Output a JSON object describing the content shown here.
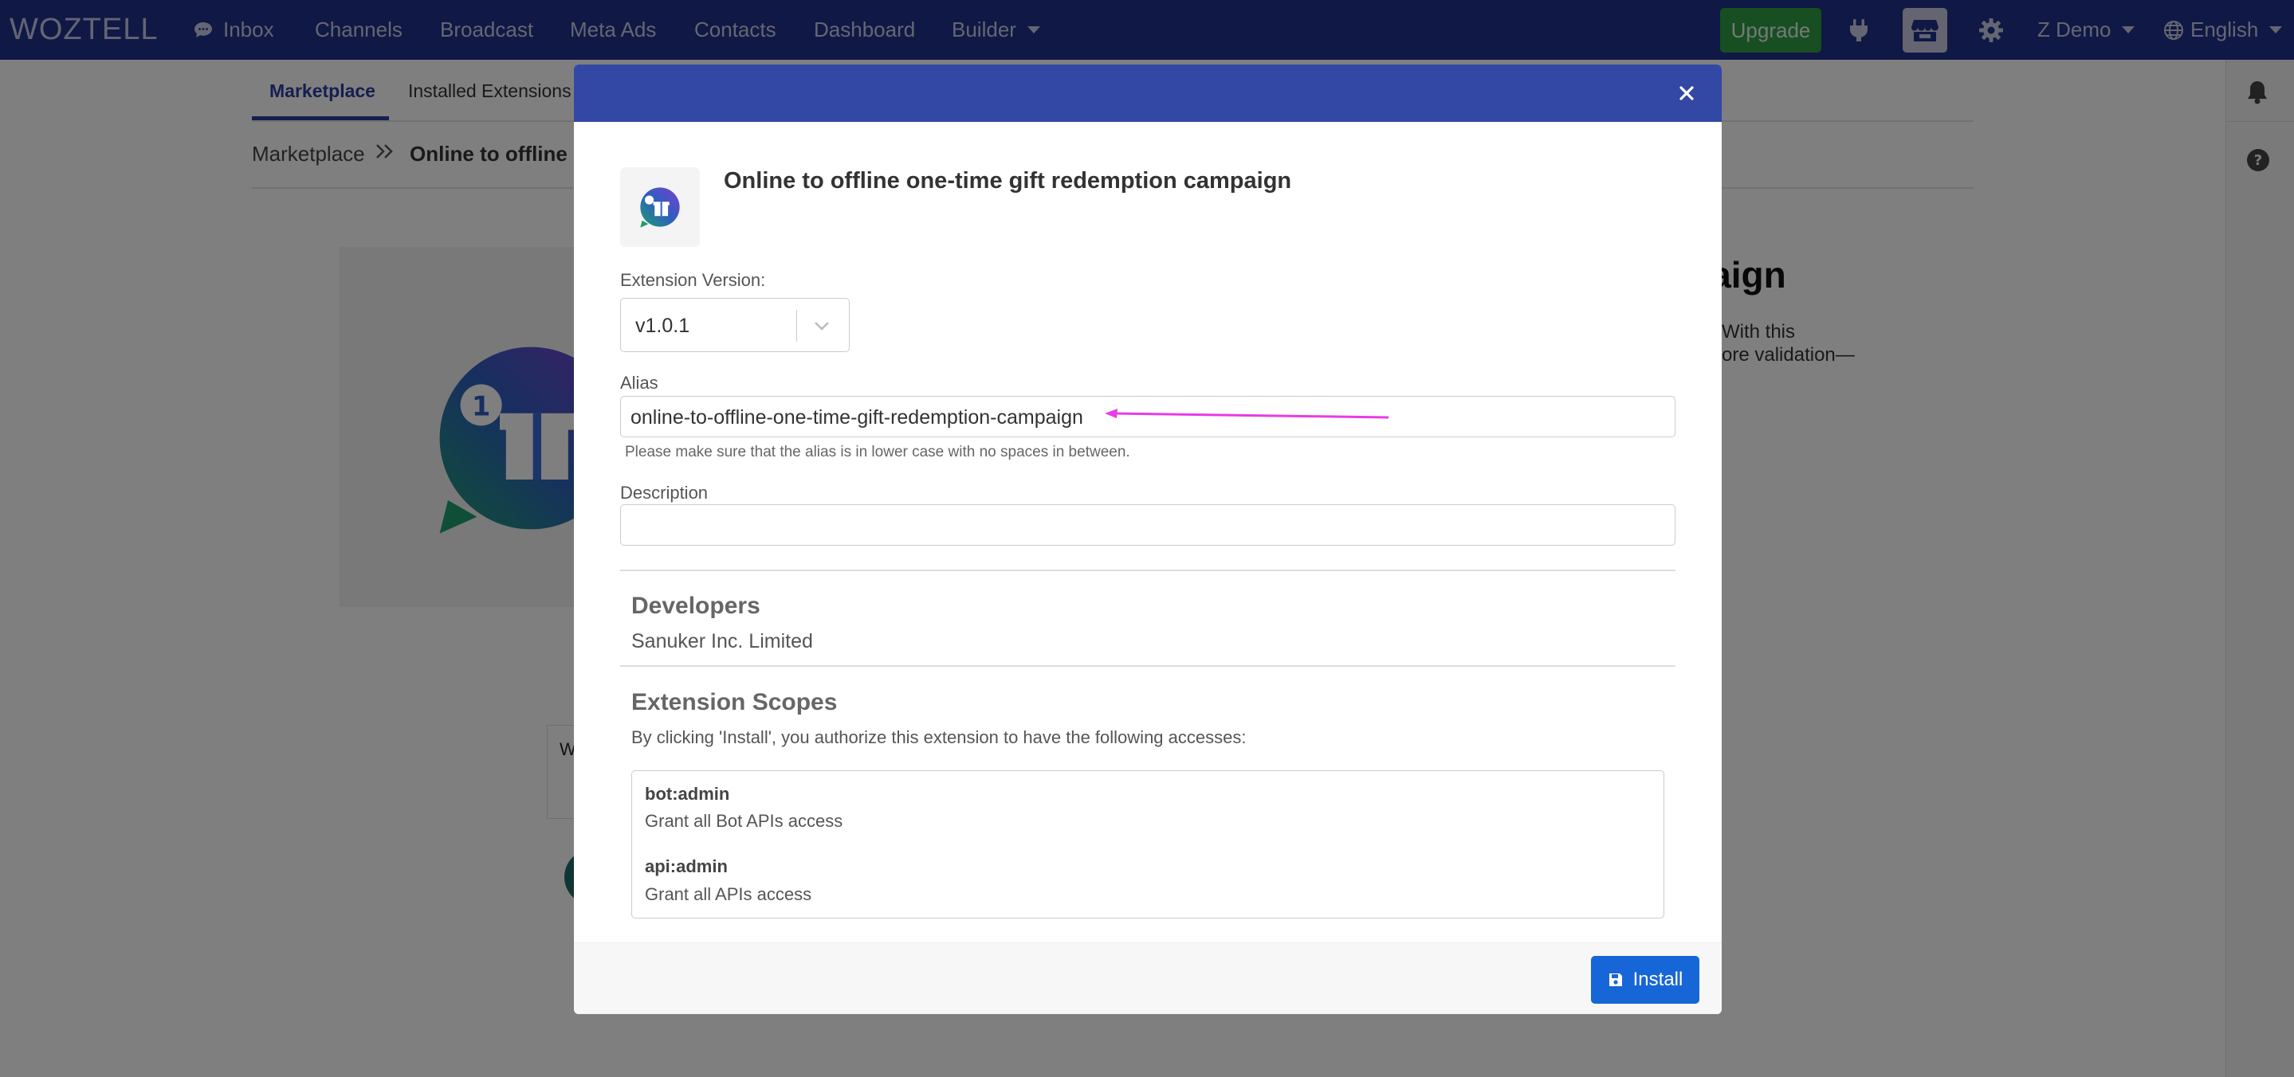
{
  "nav": {
    "logo": "WOZTELL",
    "inbox": "Inbox",
    "channels": "Channels",
    "broadcast": "Broadcast",
    "meta_ads": "Meta Ads",
    "contacts": "Contacts",
    "dashboard": "Dashboard",
    "builder": "Builder",
    "upgrade": "Upgrade",
    "account": "Z Demo",
    "language": "English"
  },
  "page": {
    "tabs": [
      "Marketplace",
      "Installed Extensions"
    ],
    "breadcrumb": [
      "Marketplace",
      "Online to offline o"
    ],
    "hero_title_fragment": "npaign",
    "hero_desc_line1": "With this",
    "hero_desc_line2": "ore validation—",
    "ghost_card_letter": "W"
  },
  "modal": {
    "title": "Online to offline one-time gift redemption campaign",
    "version_label": "Extension Version:",
    "version_value": "v1.0.1",
    "alias_label": "Alias",
    "alias_value": "online-to-offline-one-time-gift-redemption-campaign",
    "alias_hint": "Please make sure that the alias is in lower case with no spaces in between.",
    "description_label": "Description",
    "description_value": "",
    "developers_title": "Developers",
    "developer_name": "Sanuker Inc. Limited",
    "scopes_title": "Extension Scopes",
    "scopes_intro": "By clicking 'Install', you authorize this extension to have the following accesses:",
    "scopes": [
      {
        "name": "bot:admin",
        "desc": "Grant all Bot APIs access"
      },
      {
        "name": "api:admin",
        "desc": "Grant all APIs access"
      }
    ],
    "install_label": "Install"
  },
  "colors": {
    "nav_bg": "#21308a",
    "modal_header": "#3347a5",
    "install_button": "#1766d8",
    "upgrade_button": "#2e9c44",
    "annotation_arrow": "#e93be6"
  }
}
